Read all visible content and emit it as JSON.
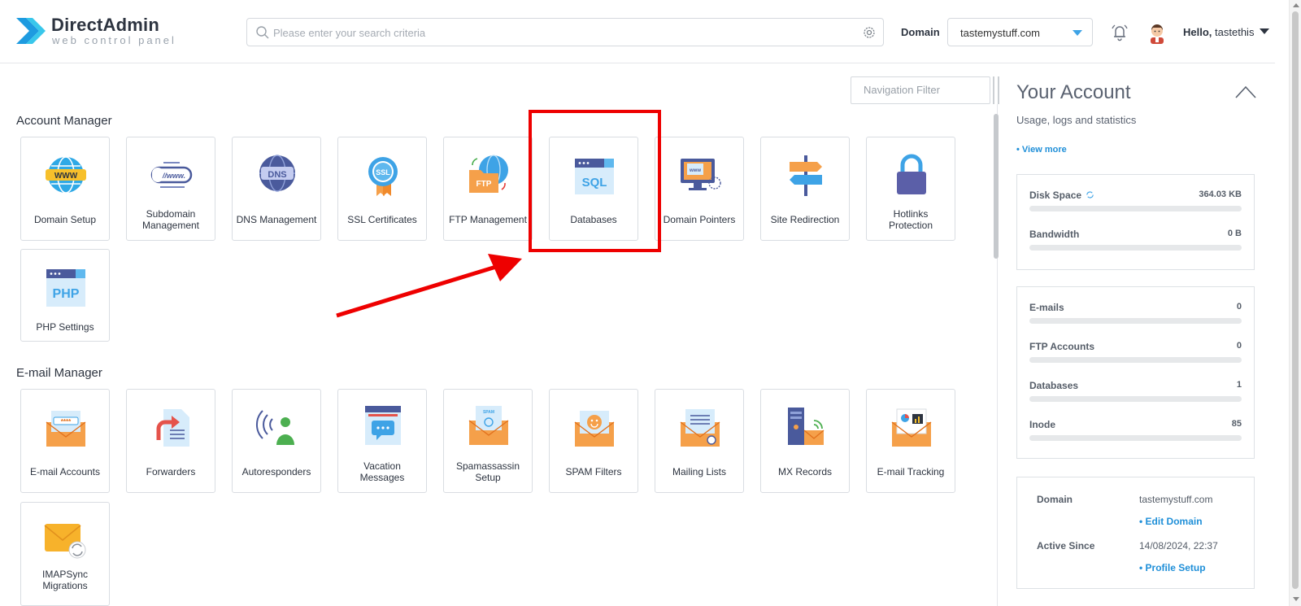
{
  "header": {
    "logo_title": "DirectAdmin",
    "logo_subtitle": "web control panel",
    "search_placeholder": "Please enter your search criteria",
    "domain_label": "Domain",
    "domain_value": "tastemystuff.com",
    "hello_prefix": "Hello,",
    "username": "tastethis"
  },
  "nav_filter_placeholder": "Navigation Filter",
  "sections": {
    "account_manager": {
      "title": "Account Manager",
      "items": [
        {
          "label": "Domain Setup",
          "icon": "globe-www-icon"
        },
        {
          "label": "Subdomain Management",
          "icon": "subdomain-link-icon"
        },
        {
          "label": "DNS Management",
          "icon": "dns-globe-icon"
        },
        {
          "label": "SSL Certificates",
          "icon": "ssl-badge-icon"
        },
        {
          "label": "FTP Management",
          "icon": "ftp-folder-icon"
        },
        {
          "label": "Databases",
          "icon": "sql-database-icon"
        },
        {
          "label": "Domain Pointers",
          "icon": "domain-pointer-monitor-icon"
        },
        {
          "label": "Site Redirection",
          "icon": "signpost-icon"
        },
        {
          "label": "Hotlinks Protection",
          "icon": "padlock-icon"
        },
        {
          "label": "PHP Settings",
          "icon": "php-window-icon"
        }
      ]
    },
    "email_manager": {
      "title": "E-mail Manager",
      "items": [
        {
          "label": "E-mail Accounts",
          "icon": "envelope-password-icon"
        },
        {
          "label": "Forwarders",
          "icon": "forward-document-icon"
        },
        {
          "label": "Autoresponders",
          "icon": "autoresponder-person-icon"
        },
        {
          "label": "Vacation Messages",
          "icon": "vacation-message-icon"
        },
        {
          "label": "Spamassassin Setup",
          "icon": "spamassassin-envelope-icon"
        },
        {
          "label": "SPAM Filters",
          "icon": "spam-filter-envelope-icon"
        },
        {
          "label": "Mailing Lists",
          "icon": "mailing-list-envelope-icon"
        },
        {
          "label": "MX Records",
          "icon": "mx-server-icon"
        },
        {
          "label": "E-mail Tracking",
          "icon": "email-tracking-chart-icon"
        },
        {
          "label": "IMAPSync Migrations",
          "icon": "imapsync-envelope-icon"
        }
      ]
    }
  },
  "account_panel": {
    "title": "Your Account",
    "subtitle": "Usage, logs and statistics",
    "view_more": "• View more",
    "usage": [
      {
        "name": "Disk Space",
        "value": "364.03 KB",
        "fraction": 0
      },
      {
        "name": "Bandwidth",
        "value": "0 B",
        "fraction": 0
      }
    ],
    "counts": [
      {
        "name": "E-mails",
        "value": "0",
        "fraction": 0
      },
      {
        "name": "FTP Accounts",
        "value": "0",
        "fraction": 0
      },
      {
        "name": "Databases",
        "value": "1",
        "fraction": 0
      },
      {
        "name": "Inode",
        "value": "85",
        "fraction": 0
      }
    ],
    "info": {
      "domain_label": "Domain",
      "domain_value": "tastemystuff.com",
      "edit_domain": "• Edit Domain",
      "active_since_label": "Active Since",
      "active_since_value": "14/08/2024, 22:37",
      "profile_setup": "• Profile Setup"
    }
  },
  "colors": {
    "accent": "#3ea3e6",
    "link": "#1f8fd8",
    "annotation": "#ee0000"
  }
}
